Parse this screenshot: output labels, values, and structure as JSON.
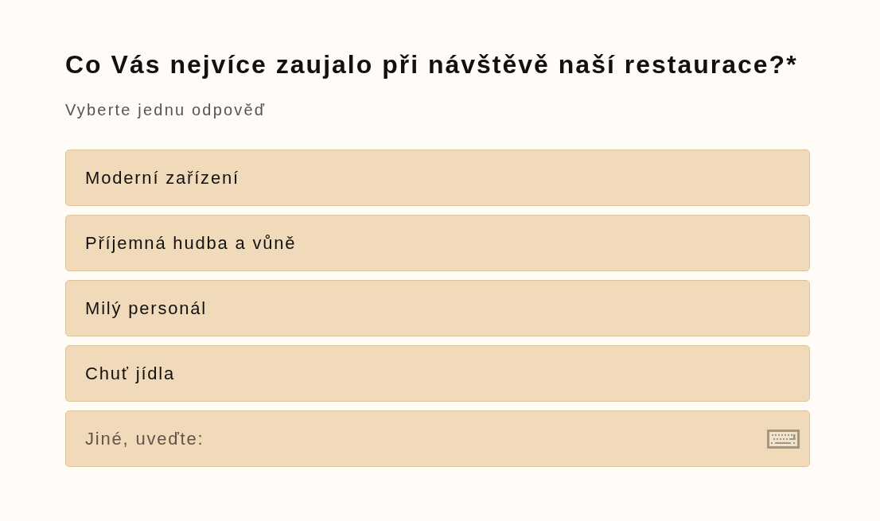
{
  "question": {
    "title": "Co Vás nejvíce zaujalo při návštěvě naší restaurace?*",
    "hint": "Vyberte jednu odpověď"
  },
  "options": [
    {
      "label": "Moderní zařízení",
      "selected": false
    },
    {
      "label": "Příjemná hudba a vůně",
      "selected": false
    },
    {
      "label": "Milý personál",
      "selected": false
    },
    {
      "label": "Chuť jídla",
      "selected": false
    }
  ],
  "other": {
    "placeholder": "Jiné, uveďte:"
  }
}
